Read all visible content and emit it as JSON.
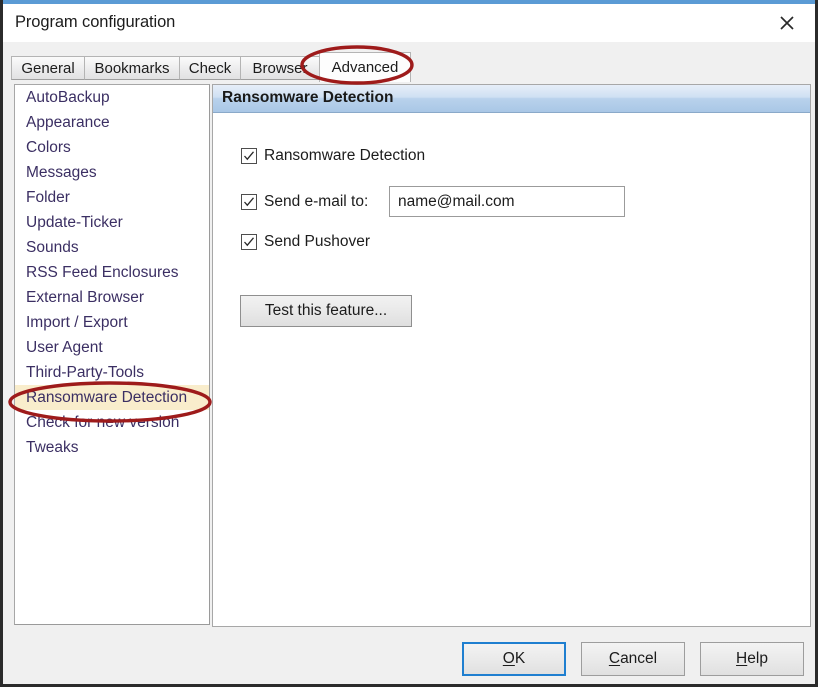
{
  "window": {
    "title": "Program configuration",
    "close_icon": "close-icon"
  },
  "tabs": [
    {
      "label": "General",
      "selected": false
    },
    {
      "label": "Bookmarks",
      "selected": false
    },
    {
      "label": "Check",
      "selected": false
    },
    {
      "label": "Browser",
      "selected": false
    },
    {
      "label": "Advanced",
      "selected": true
    }
  ],
  "sidebar": {
    "items": [
      {
        "label": "AutoBackup",
        "selected": false
      },
      {
        "label": "Appearance",
        "selected": false
      },
      {
        "label": "Colors",
        "selected": false
      },
      {
        "label": "Messages",
        "selected": false
      },
      {
        "label": "Folder",
        "selected": false
      },
      {
        "label": "Update-Ticker",
        "selected": false
      },
      {
        "label": "Sounds",
        "selected": false
      },
      {
        "label": "RSS Feed Enclosures",
        "selected": false
      },
      {
        "label": "External Browser",
        "selected": false
      },
      {
        "label": "Import / Export",
        "selected": false
      },
      {
        "label": "User Agent",
        "selected": false
      },
      {
        "label": "Third-Party-Tools",
        "selected": false
      },
      {
        "label": "Ransomware Detection",
        "selected": true
      },
      {
        "label": "Check for new version",
        "selected": false
      },
      {
        "label": "Tweaks",
        "selected": false
      }
    ]
  },
  "panel": {
    "header": "Ransomware Detection",
    "checkboxes": [
      {
        "label": "Ransomware Detection",
        "checked": true
      },
      {
        "label": "Send e-mail to:",
        "checked": true
      },
      {
        "label": "Send Pushover",
        "checked": true
      }
    ],
    "email": {
      "value": "name@mail.com",
      "placeholder": "name@mail.com"
    },
    "test_button": "Test this feature..."
  },
  "buttons": {
    "ok": {
      "pre": "",
      "accel": "O",
      "post": "K",
      "default": true
    },
    "cancel": {
      "pre": "",
      "accel": "C",
      "post": "ancel",
      "default": false
    },
    "help": {
      "pre": "",
      "accel": "H",
      "post": "elp",
      "default": false
    }
  },
  "annotations": [
    {
      "name": "advanced-tab-highlight",
      "color": "#9e1b1b"
    },
    {
      "name": "ransomware-detection-highlight",
      "color": "#9e1b1b"
    }
  ],
  "colors": {
    "accent_blue": "#5b9bd5",
    "annotation_red": "#9e1b1b",
    "sidebar_text": "#3b2f63",
    "selected_row": "#f9edcc",
    "header_blue": "#a9c7e6"
  }
}
